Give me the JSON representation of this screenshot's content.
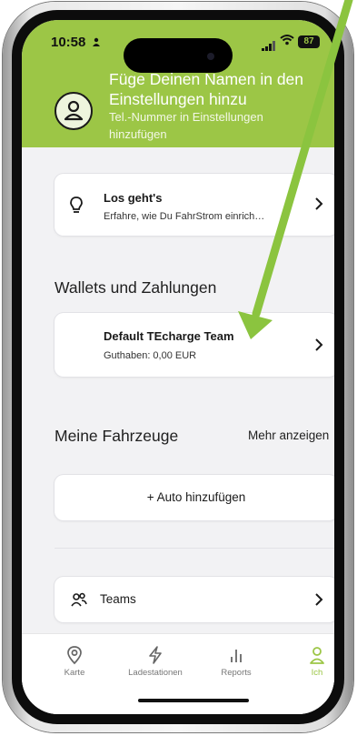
{
  "status_bar": {
    "time": "10:58",
    "battery": "87"
  },
  "header": {
    "title": "Füge Deinen Namen in den Einstellungen hinzu",
    "subtitle": "Tel.-Nummer in Einstellungen hinzufügen"
  },
  "getting_started": {
    "title": "Los geht's",
    "subtitle": "Erfahre, wie Du FahrStrom einrich…"
  },
  "wallets": {
    "heading": "Wallets und Zahlungen",
    "card_title": "Default TEcharge Team",
    "card_subtitle": "Guthaben: 0,00 EUR"
  },
  "vehicles": {
    "heading": "Meine Fahrzeuge",
    "more_label": "Mehr anzeigen",
    "add_label": "+ Auto hinzufügen"
  },
  "teams": {
    "label": "Teams"
  },
  "tabbar": {
    "items": [
      {
        "label": "Karte",
        "icon": "map-pin-icon"
      },
      {
        "label": "Ladestationen",
        "icon": "lightning-icon"
      },
      {
        "label": "Reports",
        "icon": "bar-chart-icon"
      },
      {
        "label": "Ich",
        "icon": "person-icon"
      }
    ],
    "active_color": "#9cc646"
  },
  "colors": {
    "header": "#9cc646",
    "arrow": "#8bc43f"
  }
}
